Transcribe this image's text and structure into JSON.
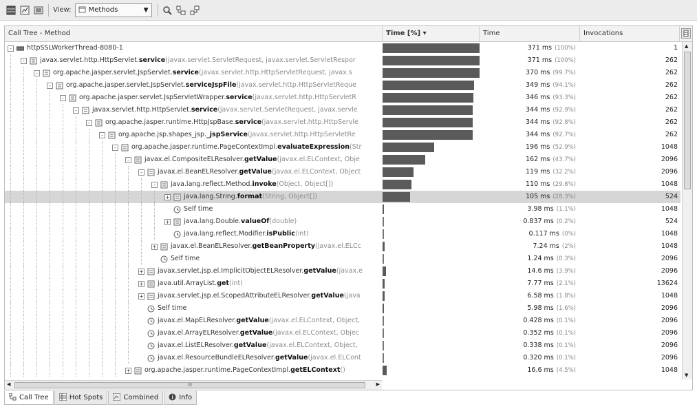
{
  "toolbar": {
    "view_label": "View:",
    "view_value": "Methods"
  },
  "columns": {
    "method": "Call Tree - Method",
    "time_pct": "Time [%] ▾",
    "time": "Time",
    "invocations": "Invocations"
  },
  "rows": [
    {
      "depth": 0,
      "expander": "-",
      "icon": "thread-icon",
      "pkg": "httpSSLWorkerThread-8080-1",
      "method": "",
      "args": "",
      "bar": 1.0,
      "time": "371 ms",
      "pct": "(100%)",
      "inv": "1"
    },
    {
      "depth": 1,
      "expander": "-",
      "icon": "method-icon",
      "pkg": "javax.servlet.http.HttpServlet.",
      "method": "service",
      "args": " (javax.servlet.ServletRequest, javax.servlet.ServletRespor",
      "bar": 1.0,
      "time": "371 ms",
      "pct": "(100%)",
      "inv": "262"
    },
    {
      "depth": 2,
      "expander": "-",
      "icon": "method-icon",
      "pkg": "org.apache.jasper.servlet.JspServlet.",
      "method": "service",
      "args": " (javax.servlet.http.HttpServletRequest, javax.s",
      "bar": 0.997,
      "time": "370 ms",
      "pct": "(99.7%)",
      "inv": "262"
    },
    {
      "depth": 3,
      "expander": "-",
      "icon": "method-icon",
      "pkg": "org.apache.jasper.servlet.JspServlet.",
      "method": "serviceJspFile",
      "args": " (javax.servlet.http.HttpServletReque",
      "bar": 0.941,
      "time": "349 ms",
      "pct": "(94.1%)",
      "inv": "262"
    },
    {
      "depth": 4,
      "expander": "-",
      "icon": "method-icon",
      "pkg": "org.apache.jasper.servlet.JspServletWrapper.",
      "method": "service",
      "args": " (javax.servlet.http.HttpServletR",
      "bar": 0.933,
      "time": "346 ms",
      "pct": "(93.3%)",
      "inv": "262"
    },
    {
      "depth": 5,
      "expander": "-",
      "icon": "method-icon",
      "pkg": "javax.servlet.http.HttpServlet.",
      "method": "service",
      "args": " (javax.servlet.ServletRequest, javax.servle",
      "bar": 0.929,
      "time": "344 ms",
      "pct": "(92.9%)",
      "inv": "262"
    },
    {
      "depth": 6,
      "expander": "-",
      "icon": "method-icon",
      "pkg": "org.apache.jasper.runtime.HttpJspBase.",
      "method": "service",
      "args": " (javax.servlet.http.HttpServle",
      "bar": 0.928,
      "time": "344 ms",
      "pct": "(92.8%)",
      "inv": "262"
    },
    {
      "depth": 7,
      "expander": "-",
      "icon": "method-icon",
      "pkg": "org.apache.jsp.shapes_jsp.",
      "method": "_jspService",
      "args": " (javax.servlet.http.HttpServletRe",
      "bar": 0.927,
      "time": "344 ms",
      "pct": "(92.7%)",
      "inv": "262"
    },
    {
      "depth": 8,
      "expander": "-",
      "icon": "method-icon",
      "pkg": "org.apache.jasper.runtime.PageContextImpl.",
      "method": "evaluateExpression",
      "args": " (Str",
      "bar": 0.529,
      "time": "196 ms",
      "pct": "(52.9%)",
      "inv": "1048"
    },
    {
      "depth": 9,
      "expander": "-",
      "icon": "method-icon",
      "pkg": "javax.el.CompositeELResolver.",
      "method": "getValue",
      "args": " (javax.el.ELContext, Obje",
      "bar": 0.437,
      "time": "162 ms",
      "pct": "(43.7%)",
      "inv": "2096"
    },
    {
      "depth": 10,
      "expander": "-",
      "icon": "method-icon",
      "pkg": "javax.el.BeanELResolver.",
      "method": "getValue",
      "args": " (javax.el.ELContext, Object",
      "bar": 0.322,
      "time": "119 ms",
      "pct": "(32.2%)",
      "inv": "2096"
    },
    {
      "depth": 11,
      "expander": "-",
      "icon": "method-icon",
      "pkg": "java.lang.reflect.Method.",
      "method": "invoke",
      "args": " (Object, Object[])",
      "bar": 0.298,
      "time": "110 ms",
      "pct": "(29.8%)",
      "inv": "1048"
    },
    {
      "depth": 12,
      "expander": "+",
      "icon": "method-icon",
      "pkg": "java.lang.String.",
      "method": "format",
      "args": " (String, Object[])",
      "bar": 0.283,
      "time": "105 ms",
      "pct": "(28.3%)",
      "inv": "524",
      "selected": true
    },
    {
      "depth": 12,
      "expander": "",
      "icon": "clock-icon",
      "pkg": "Self time",
      "method": "",
      "args": "",
      "bar": 0.011,
      "time": "3.98 ms",
      "pct": "(1.1%)",
      "inv": "1048"
    },
    {
      "depth": 12,
      "expander": "+",
      "icon": "method-icon",
      "pkg": "java.lang.Double.",
      "method": "valueOf",
      "args": " (double)",
      "bar": 0.002,
      "time": "0.837 ms",
      "pct": "(0.2%)",
      "inv": "524"
    },
    {
      "depth": 12,
      "expander": "",
      "icon": "clock-icon",
      "pkg": "java.lang.reflect.Modifier.",
      "method": "isPublic",
      "args": " (int)",
      "bar": 0.0,
      "time": "0.117 ms",
      "pct": "(0%)",
      "inv": "1048"
    },
    {
      "depth": 11,
      "expander": "+",
      "icon": "method-icon",
      "pkg": "javax.el.BeanELResolver.",
      "method": "getBeanProperty",
      "args": " (javax.el.ELCc",
      "bar": 0.02,
      "time": "7.24 ms",
      "pct": "(2%)",
      "inv": "1048"
    },
    {
      "depth": 11,
      "expander": "",
      "icon": "clock-icon",
      "pkg": "Self time",
      "method": "",
      "args": "",
      "bar": 0.003,
      "time": "1.24 ms",
      "pct": "(0.3%)",
      "inv": "2096"
    },
    {
      "depth": 10,
      "expander": "+",
      "icon": "method-icon",
      "pkg": "javax.servlet.jsp.el.ImplicitObjectELResolver.",
      "method": "getValue",
      "args": " (javax.e",
      "bar": 0.039,
      "time": "14.6 ms",
      "pct": "(3.9%)",
      "inv": "2096"
    },
    {
      "depth": 10,
      "expander": "+",
      "icon": "method-icon",
      "pkg": "java.util.ArrayList.",
      "method": "get",
      "args": " (int)",
      "bar": 0.021,
      "time": "7.77 ms",
      "pct": "(2.1%)",
      "inv": "13624"
    },
    {
      "depth": 10,
      "expander": "+",
      "icon": "method-icon",
      "pkg": "javax.servlet.jsp.el.ScopedAttributeELResolver.",
      "method": "getValue",
      "args": " (java",
      "bar": 0.018,
      "time": "6.58 ms",
      "pct": "(1.8%)",
      "inv": "1048"
    },
    {
      "depth": 10,
      "expander": "",
      "icon": "clock-icon",
      "pkg": "Self time",
      "method": "",
      "args": "",
      "bar": 0.016,
      "time": "5.98 ms",
      "pct": "(1.6%)",
      "inv": "2096"
    },
    {
      "depth": 10,
      "expander": "",
      "icon": "clock-icon",
      "pkg": "javax.el.MapELResolver.",
      "method": "getValue",
      "args": " (javax.el.ELContext, Object,",
      "bar": 0.001,
      "time": "0.428 ms",
      "pct": "(0.1%)",
      "inv": "2096"
    },
    {
      "depth": 10,
      "expander": "",
      "icon": "clock-icon",
      "pkg": "javax.el.ArrayELResolver.",
      "method": "getValue",
      "args": " (javax.el.ELContext, Objec",
      "bar": 0.001,
      "time": "0.352 ms",
      "pct": "(0.1%)",
      "inv": "2096"
    },
    {
      "depth": 10,
      "expander": "",
      "icon": "clock-icon",
      "pkg": "javax.el.ListELResolver.",
      "method": "getValue",
      "args": " (javax.el.ELContext, Object,",
      "bar": 0.001,
      "time": "0.338 ms",
      "pct": "(0.1%)",
      "inv": "2096"
    },
    {
      "depth": 10,
      "expander": "",
      "icon": "clock-icon",
      "pkg": "javax.el.ResourceBundleELResolver.",
      "method": "getValue",
      "args": " (javax.el.ELCont",
      "bar": 0.001,
      "time": "0.320 ms",
      "pct": "(0.1%)",
      "inv": "2096"
    },
    {
      "depth": 9,
      "expander": "+",
      "icon": "method-icon",
      "pkg": "org.apache.jasper.runtime.PageContextImpl.",
      "method": "getELContext",
      "args": " ()",
      "bar": 0.045,
      "time": "16.6 ms",
      "pct": "(4.5%)",
      "inv": "1048"
    }
  ],
  "hscroll_label": "III",
  "tabs": [
    {
      "label": "Call Tree",
      "icon": "call-tree-icon"
    },
    {
      "label": "Hot Spots",
      "icon": "hot-spots-icon"
    },
    {
      "label": "Combined",
      "icon": "combined-icon"
    },
    {
      "label": "Info",
      "icon": "info-icon"
    }
  ]
}
